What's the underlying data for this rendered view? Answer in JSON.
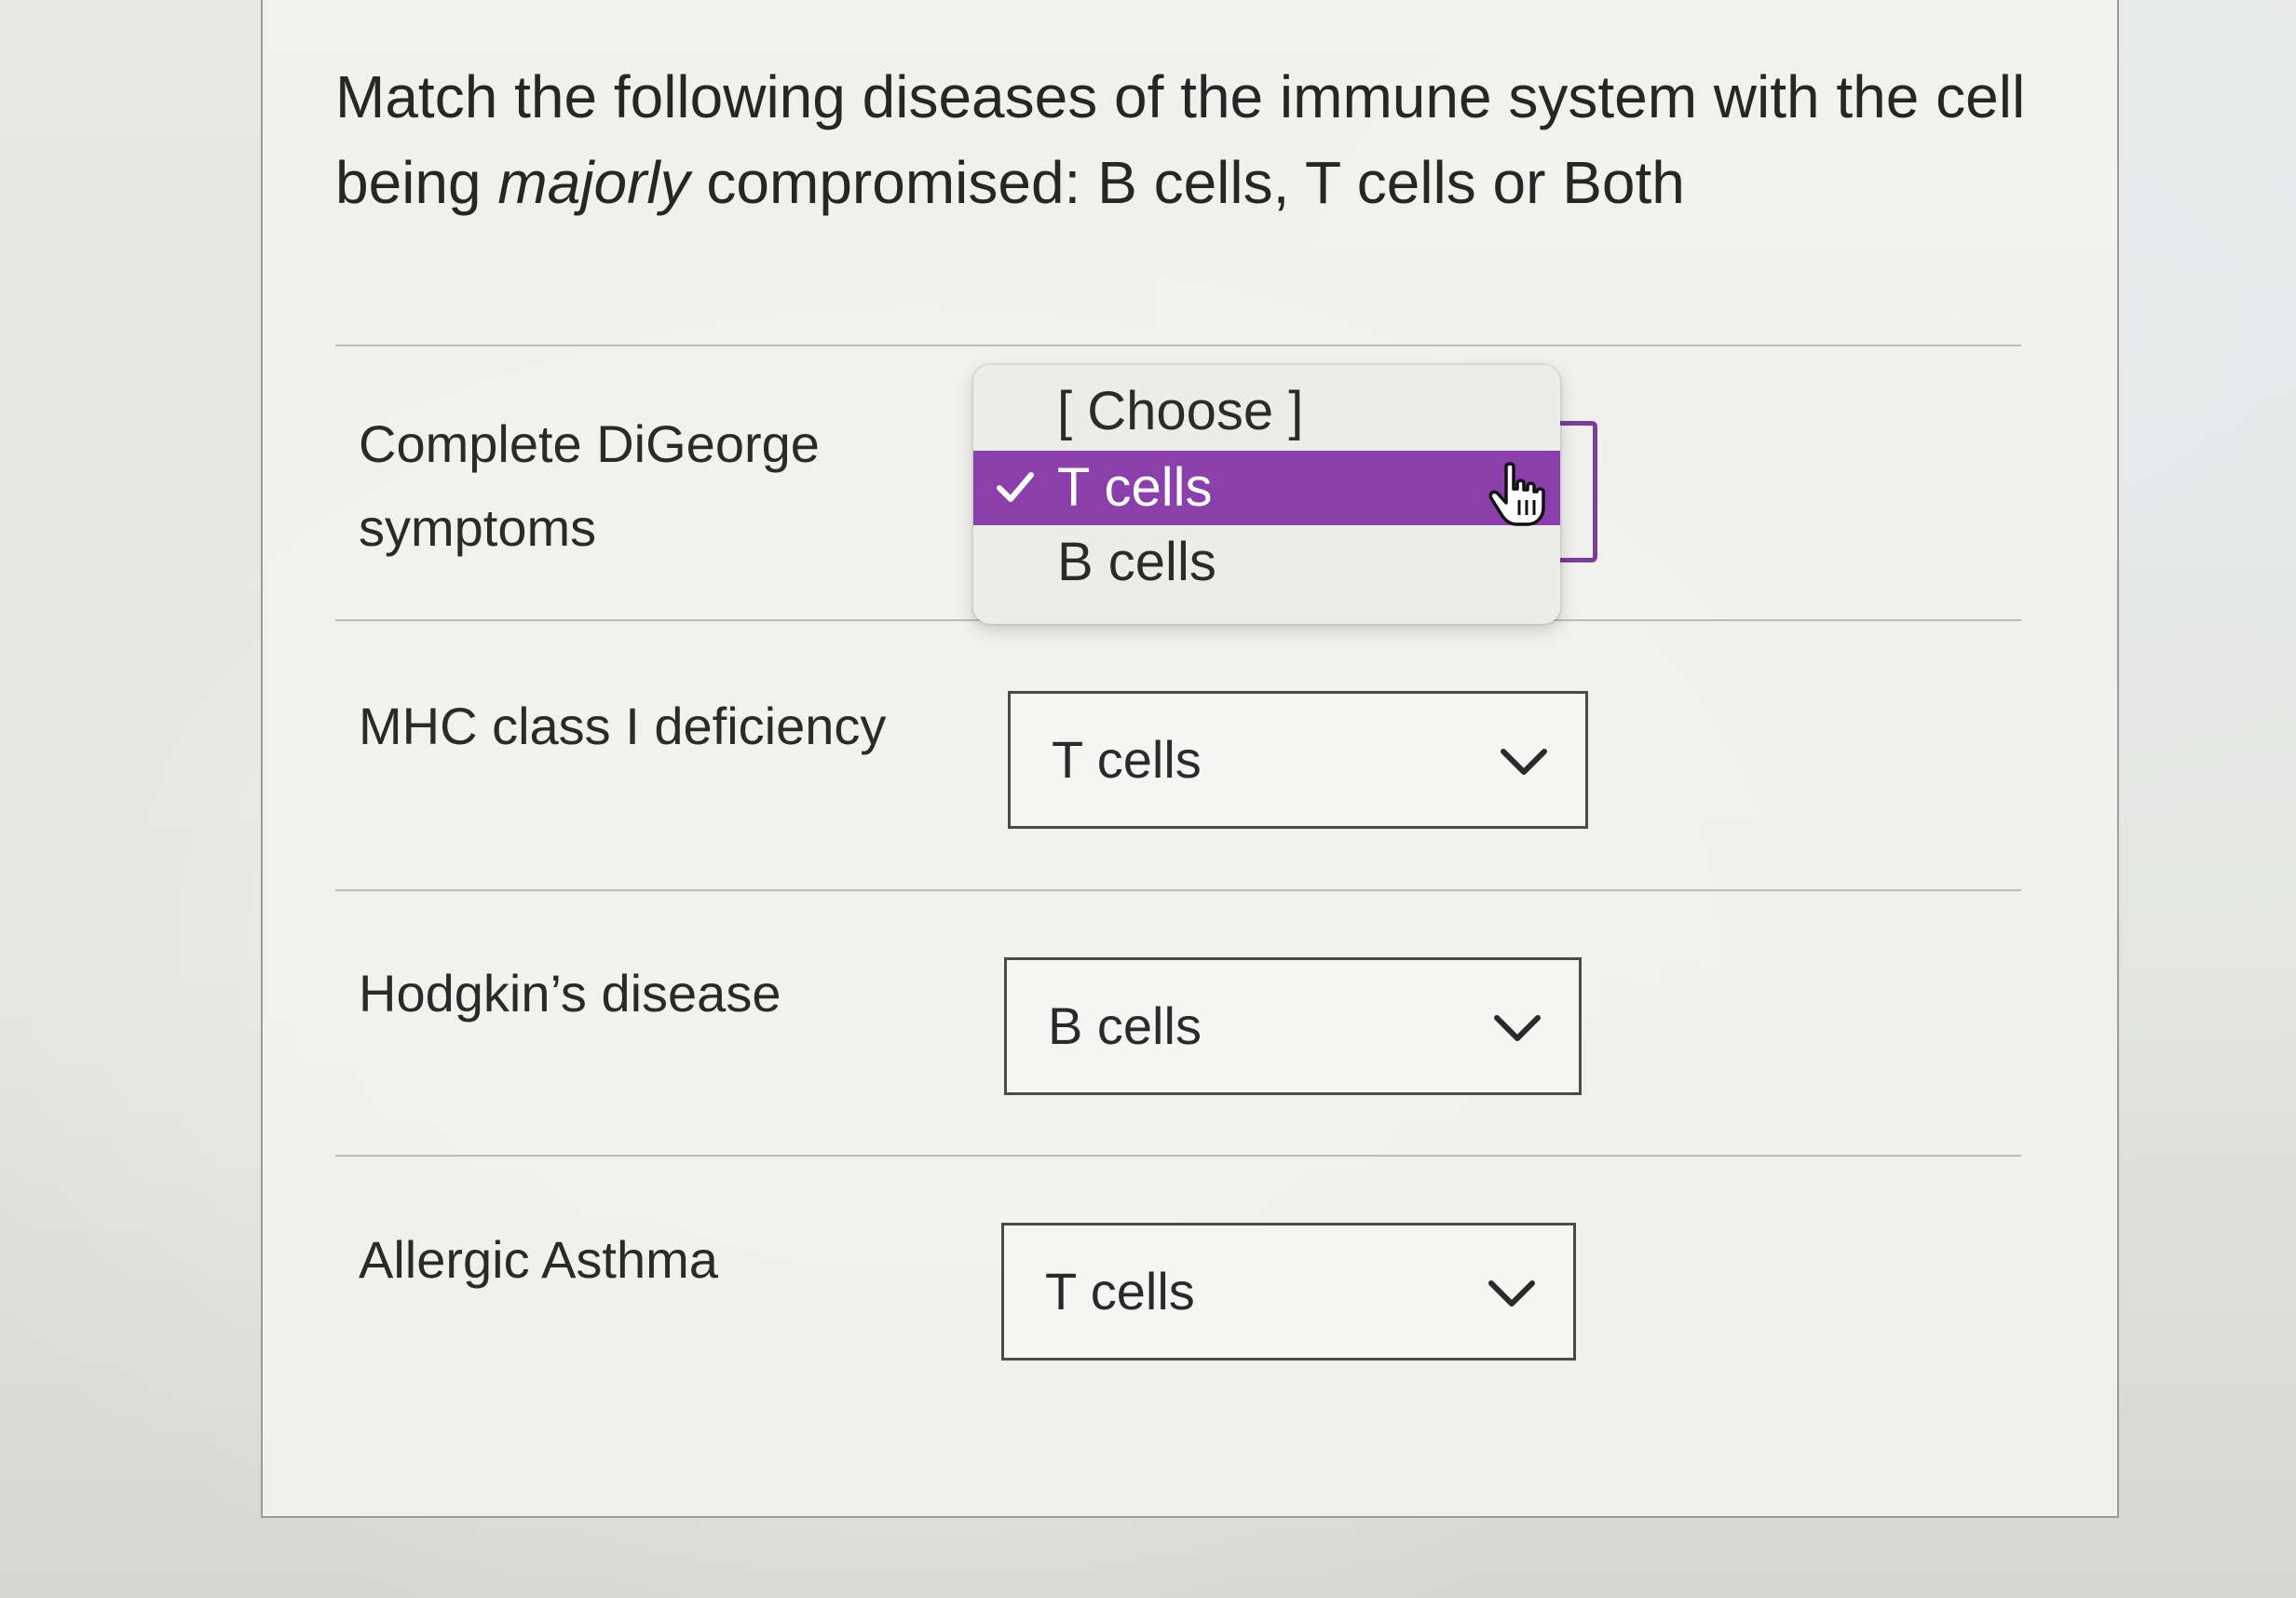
{
  "question": {
    "prefix": "Match the following diseases of the immune system with the cell being ",
    "emphasis": "majorly",
    "suffix": " compromised: B cells, T cells or Both"
  },
  "rows": [
    {
      "label_line1": "Complete DiGeorge",
      "label_line2": "symptoms",
      "dropdown_open": true,
      "options": [
        "[ Choose ]",
        "T cells",
        "B cells"
      ],
      "selected": "T cells"
    },
    {
      "label": "MHC class I deficiency",
      "value": "T cells"
    },
    {
      "label": "Hodgkin’s disease",
      "value": "B cells"
    },
    {
      "label": "Allergic Asthma",
      "value": "T cells"
    }
  ],
  "icons": {
    "dropdown": "chevron-down-icon",
    "check": "checkmark-icon",
    "cursor": "hand-pointer-icon"
  },
  "colors": {
    "selected_option_bg": "#8a3fab",
    "select_border": "#4a4a4a"
  }
}
